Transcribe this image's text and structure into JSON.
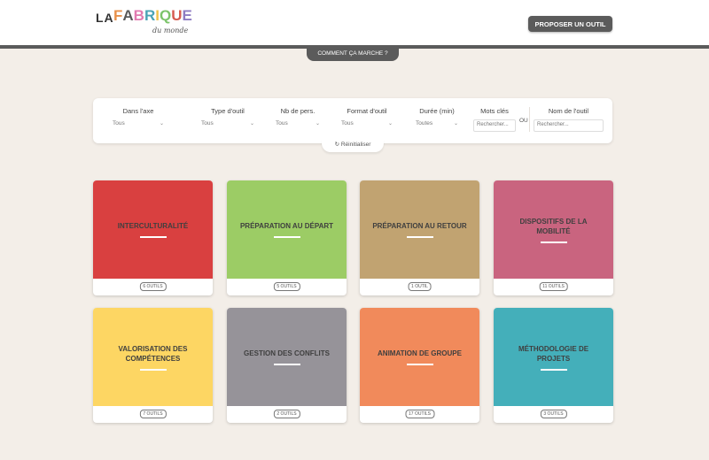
{
  "header": {
    "logo": {
      "prefix": "LA",
      "letters": [
        "F",
        "A",
        "B",
        "R",
        "I",
        "Q",
        "U",
        "E"
      ],
      "letter_colors": [
        "#e8904a",
        "#5a5a5a",
        "#e27bb0",
        "#4aa3b5",
        "#f0c24a",
        "#7cc46a",
        "#d65a4e",
        "#8e7bc2"
      ],
      "sub": "du monde"
    },
    "propose_label": "PROPOSER UN OUTIL"
  },
  "how_label": "COMMENT ÇA MARCHE ?",
  "filters": {
    "items": [
      {
        "label": "Dans l'axe",
        "value": "Tous"
      },
      {
        "label": "Type d'outil",
        "value": "Tous"
      },
      {
        "label": "Nb de pers.",
        "value": "Tous"
      },
      {
        "label": "Format d'outil",
        "value": "Tous"
      },
      {
        "label": "Durée (min)",
        "value": "Toutes"
      }
    ],
    "keywords_label": "Mots clés",
    "keywords_placeholder": "Rechercher...",
    "or_label": "OU",
    "name_label": "Nom de l'outil",
    "name_placeholder": "Rechercher...",
    "reset_label": "Réinitialiser"
  },
  "cards": [
    {
      "title": "INTERCULTURALITÉ",
      "count": "6 OUTILS",
      "color": "#d94040"
    },
    {
      "title": "PRÉPARATION AU DÉPART",
      "count": "5 OUTILS",
      "color": "#9ccc65"
    },
    {
      "title": "PRÉPARATION AU RETOUR",
      "count": "1 OUTIL",
      "color": "#c1a371"
    },
    {
      "title": "DISPOSITIFS DE LA MOBILITÉ",
      "count": "11 OUTILS",
      "color": "#c9647f"
    },
    {
      "title": "VALORISATION DES COMPÉTENCES",
      "count": "7 OUTILS",
      "color": "#fdd663"
    },
    {
      "title": "GESTION DES CONFLITS",
      "count": "2 OUTILS",
      "color": "#969399"
    },
    {
      "title": "ANIMATION DE GROUPE",
      "count": "17 OUTILS",
      "color": "#f18a5b"
    },
    {
      "title": "MÉTHODOLOGIE DE PROJETS",
      "count": "3 OUTILS",
      "color": "#44afba"
    }
  ]
}
